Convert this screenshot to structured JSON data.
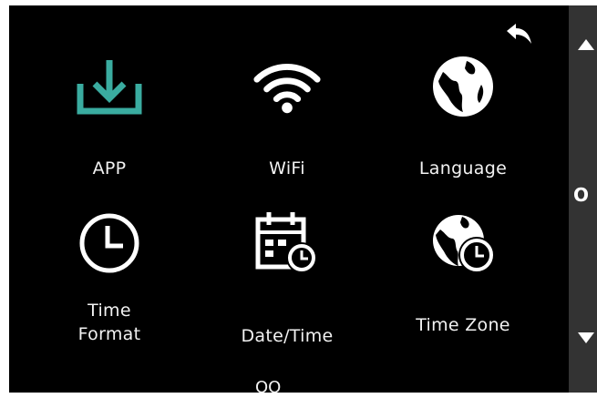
{
  "screen": {
    "tiles": [
      {
        "label": "APP",
        "icon": "download-icon",
        "color": "#3aaca0"
      },
      {
        "label": "WiFi",
        "icon": "wifi-icon"
      },
      {
        "label": "Language",
        "icon": "globe-icon"
      },
      {
        "label": "Time\nFormat",
        "icon": "clock-icon"
      },
      {
        "label": "Date/Time",
        "icon": "calendar-clock-icon"
      },
      {
        "label": "Time Zone",
        "icon": "globe-clock-icon"
      }
    ],
    "partial_label": "OO",
    "back_icon": "back-arrow-icon"
  },
  "sidebar": {
    "label": "O",
    "up_icon": "triangle-up-icon",
    "down_icon": "triangle-down-icon",
    "background": "#333333"
  },
  "colors": {
    "accent": "#3aaca0",
    "background": "#000000",
    "text": "#f2f2f2"
  }
}
